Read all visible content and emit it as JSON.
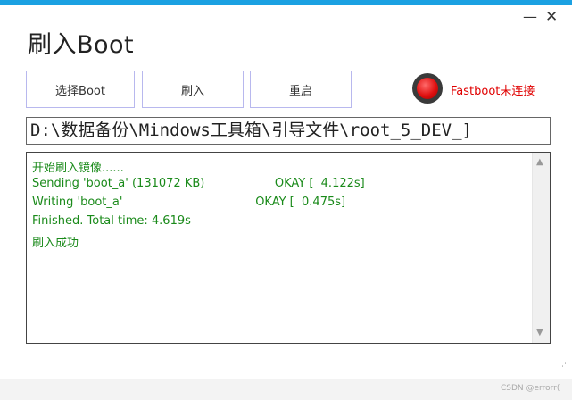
{
  "window": {
    "title": "刷入Boot",
    "minimize_glyph": "—",
    "close_glyph": "✕",
    "accent_color": "#1ba1e2"
  },
  "toolbar": {
    "select_boot_label": "选择Boot",
    "flash_label": "刷入",
    "reboot_label": "重启"
  },
  "status": {
    "indicator_color": "#e01010",
    "text": "Fastboot未连接",
    "text_color": "#e00000"
  },
  "path": {
    "value": "D:\\数据备份\\Mindows工具箱\\引导文件\\root_5_DEV_]"
  },
  "log": {
    "text_color": "#1a8a1a",
    "lines": [
      "开始刷入镜像......",
      "Sending 'boot_a' (131072 KB)                   OKAY [  4.122s]",
      "Writing 'boot_a'                                    OKAY [  0.475s]",
      "Finished. Total time: 4.619s",
      "刷入成功"
    ]
  },
  "scrollbar": {
    "up_icon": "▲",
    "down_icon": "▼"
  },
  "resize_grip_glyph": "⋰",
  "watermark": "CSDN @errorr("
}
